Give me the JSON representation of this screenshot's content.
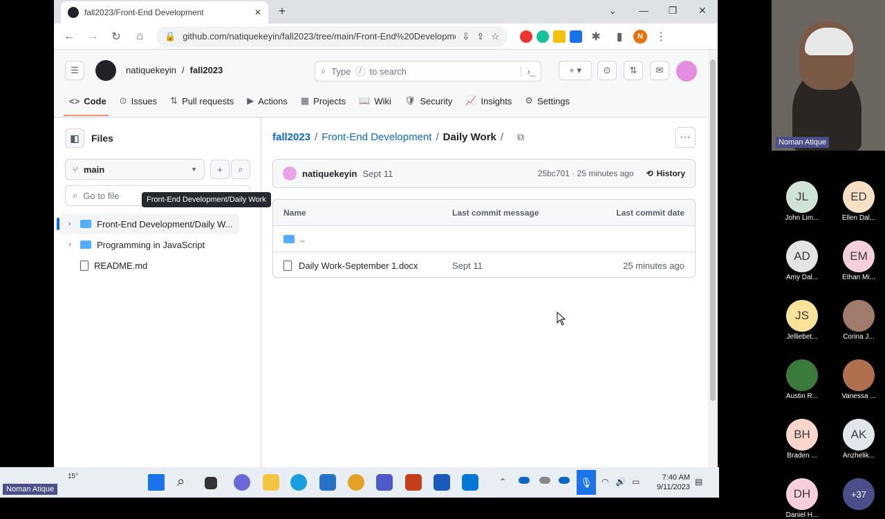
{
  "browser": {
    "tab_title": "fall2023/Front-End Development",
    "url": "github.com/natiquekeyin/fall2023/tree/main/Front-End%20Development/D...",
    "profile_initial": "N"
  },
  "github": {
    "owner": "natiquekeyin",
    "repo": "fall2023",
    "search_placeholder_pre": "Type",
    "search_key": "/",
    "search_placeholder_post": "to search",
    "tabs": [
      {
        "label": "Code",
        "icon": "<>"
      },
      {
        "label": "Issues",
        "icon": "⊙"
      },
      {
        "label": "Pull requests",
        "icon": "⇅"
      },
      {
        "label": "Actions",
        "icon": "▶"
      },
      {
        "label": "Projects",
        "icon": "▦"
      },
      {
        "label": "Wiki",
        "icon": "📖"
      },
      {
        "label": "Security",
        "icon": "🛡"
      },
      {
        "label": "Insights",
        "icon": "📈"
      },
      {
        "label": "Settings",
        "icon": "⚙"
      }
    ]
  },
  "sidebar": {
    "title": "Files",
    "branch": "main",
    "goto_placeholder": "Go to file",
    "tooltip": "Front-End Development/Daily Work",
    "tree": [
      {
        "label": "Front-End Development/Daily W...",
        "type": "folder"
      },
      {
        "label": "Programming in JavaScript",
        "type": "folder"
      },
      {
        "label": "README.md",
        "type": "file"
      }
    ]
  },
  "main": {
    "path": {
      "root": "fall2023",
      "mid": "Front-End Development",
      "current": "Daily Work",
      "trail": "/"
    },
    "commit": {
      "author": "natiquekeyin",
      "date": "Sept 11",
      "hash": "25bc701 · 25 minutes ago",
      "history": "History"
    },
    "table": {
      "headers": {
        "name": "Name",
        "message": "Last commit message",
        "date": "Last commit date"
      },
      "parent": "..",
      "rows": [
        {
          "name": "Daily Work-September 1.docx",
          "message": "Sept 11",
          "date": "25 minutes ago"
        }
      ]
    }
  },
  "meeting": {
    "presenter": "Noman Atique",
    "participants": [
      {
        "initials": "JL",
        "name": "John Lim...",
        "color": "#cfe3d7"
      },
      {
        "initials": "ED",
        "name": "Ellen Dal...",
        "color": "#f6dfc4"
      },
      {
        "initials": "AD",
        "name": "Amy Dal...",
        "color": "#e4e4e4"
      },
      {
        "initials": "EM",
        "name": "Ethan Mi...",
        "color": "#f5d0dc"
      },
      {
        "initials": "JS",
        "name": "Jelliebet...",
        "color": "#f9e29a"
      },
      {
        "initials": "",
        "name": "Corina J...",
        "color": "#a07a6a"
      },
      {
        "initials": "",
        "name": "Austin R...",
        "color": "#3a7a3a"
      },
      {
        "initials": "",
        "name": "Vanessa ...",
        "color": "#b07050"
      },
      {
        "initials": "BH",
        "name": "Braden ...",
        "color": "#f8d6cc"
      },
      {
        "initials": "AK",
        "name": "Anzhelik...",
        "color": "#dfe7ec"
      },
      {
        "initials": "DH",
        "name": "Daniel H...",
        "color": "#f5d0d8"
      },
      {
        "initials": "+37",
        "name": "",
        "color": "#4a4f8a"
      }
    ]
  },
  "taskbar": {
    "weather": "15°",
    "time": "7:40 AM",
    "date": "9/11/2023"
  }
}
